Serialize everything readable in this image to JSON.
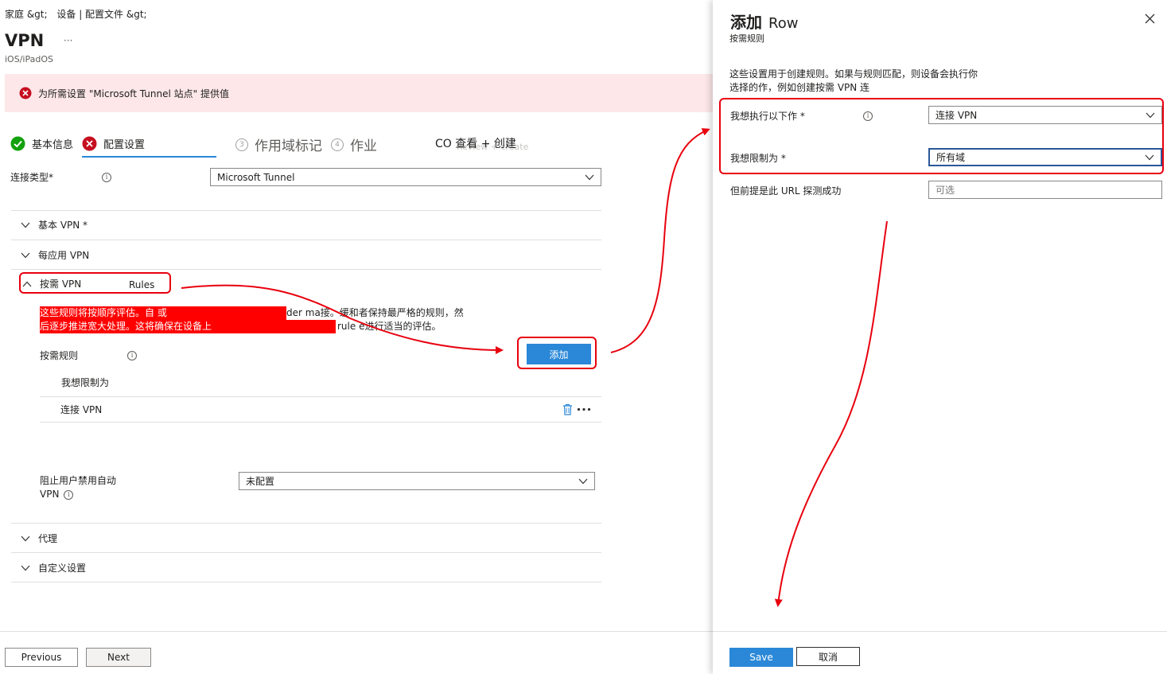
{
  "breadcrumb": {
    "part1": "家庭 &gt;",
    "part2": "设备 | 配置文件 &gt;"
  },
  "page": {
    "title": "VPN",
    "more": "···",
    "subtitle": "iOS/iPadOS"
  },
  "error_banner": {
    "text": "为所需设置 \"Microsoft Tunnel 站点\" 提供值"
  },
  "steps": [
    {
      "label": "基本信息",
      "state": "done"
    },
    {
      "label": "配置设置",
      "state": "error"
    },
    {
      "number": "3",
      "label": "作用域标记",
      "state": "todo"
    },
    {
      "number": "4",
      "label": "作业",
      "state": "todo"
    },
    {
      "label": "CO 查看 + 创建",
      "ghost": "Review + create",
      "state": "todo"
    }
  ],
  "connection_type": {
    "label": "连接类型*",
    "value": "Microsoft Tunnel"
  },
  "sections": {
    "basic_vpn": "基本 VPN *",
    "per_app_vpn": "每应用 VPN",
    "on_demand": "按需 VPN",
    "on_demand_extra": "Rules",
    "proxy": "代理",
    "custom": "自定义设置"
  },
  "on_demand": {
    "desc_line1_a": "这些规则将按顺序评估。自 或",
    "desc_line1_b": "der ma接。缓和者保持最严格的规则，然",
    "desc_line2_a": "后逐步推进宽大处理。这将确保在设备上",
    "desc_line2_b": "rule e进行适当的评估。",
    "rules_label": "按需规则",
    "add_button": "添加",
    "table_header": "我想限制为",
    "row_value": "连接 VPN"
  },
  "block_auto": {
    "label_line1": "阻止用户禁用自动",
    "label_line2": "VPN",
    "value": "未配置"
  },
  "footer": {
    "previous": "Previous",
    "next": "Next"
  },
  "panel": {
    "title_main": "添加",
    "title_extra": "Row",
    "subtitle": "按需规则",
    "desc_line1": "这些设置用于创建规则。如果与规则匹配，则设备会执行你",
    "desc_line2": "选择的作，例如创建按需 VPN 连",
    "action_label": "我想执行以下作 *",
    "action_value": "连接 VPN",
    "restrict_label": "我想限制为 *",
    "restrict_value": "所有域",
    "url_label": "但前提是此 URL 探测成功",
    "url_placeholder": "可选",
    "save": "Save",
    "cancel": "取消"
  },
  "colors": {
    "accent": "#2b88d8",
    "error": "#c50f1f",
    "success": "#13a10e",
    "annotation": "#e8000e"
  }
}
